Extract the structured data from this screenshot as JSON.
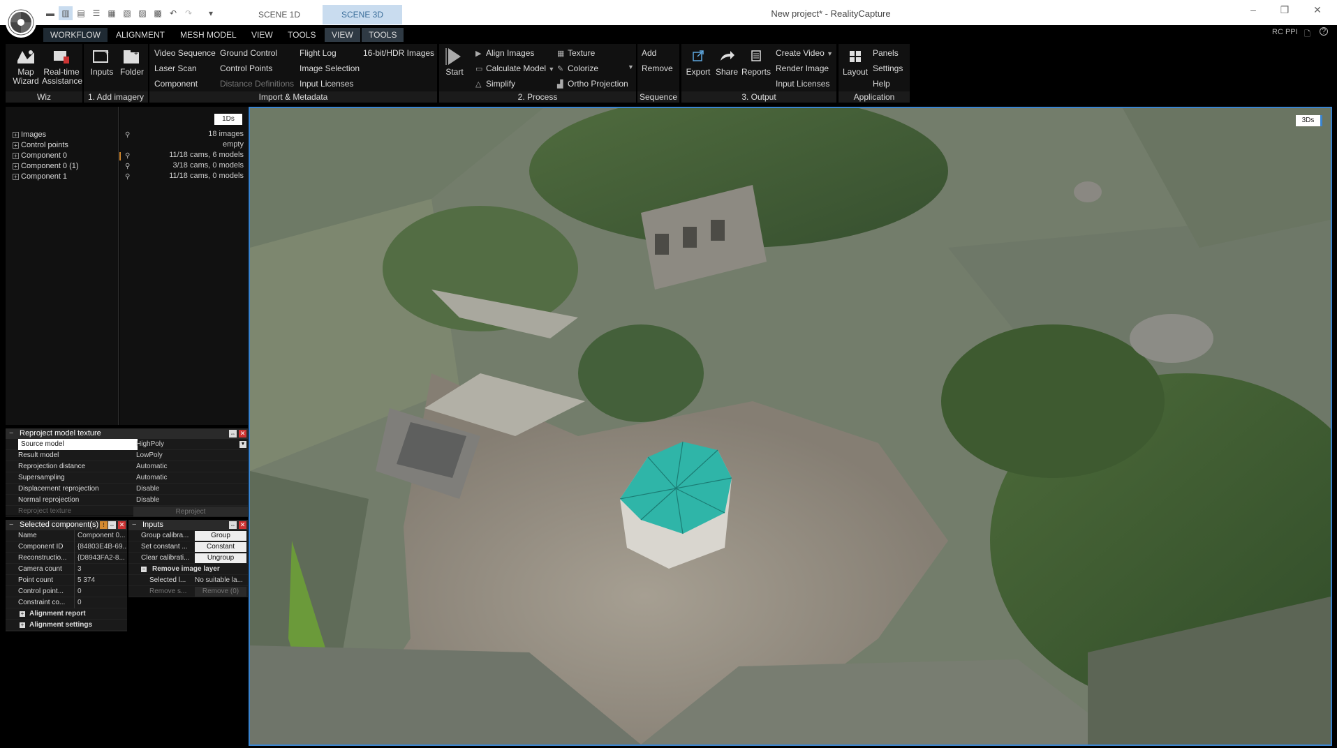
{
  "window": {
    "title": "New project* - RealityCapture",
    "scene_tabs": [
      "SCENE 1D",
      "SCENE 3D"
    ],
    "active_scene": "SCENE 3D"
  },
  "menu": {
    "items": [
      "WORKFLOW",
      "ALIGNMENT",
      "MESH MODEL",
      "VIEW",
      "TOOLS",
      "VIEW",
      "TOOLS"
    ],
    "active": "WORKFLOW",
    "right_label": "RC PPI"
  },
  "ribbon": {
    "wiz": {
      "label": "Wiz",
      "map_wizard": "Map Wizard",
      "realtime": "Real-time Assistance"
    },
    "add_imagery": {
      "label": "1. Add imagery",
      "inputs": "Inputs",
      "folder": "Folder"
    },
    "import": {
      "label": "Import & Metadata",
      "col1": [
        "Video Sequence",
        "Laser Scan",
        "Component"
      ],
      "col2": [
        "Ground Control",
        "Control Points",
        "Distance Definitions"
      ],
      "col3": [
        "Flight Log",
        "Image Selection",
        "Input Licenses"
      ],
      "col4": [
        "16-bit/HDR Images"
      ]
    },
    "process": {
      "label": "2. Process",
      "start": "Start",
      "col1": [
        "Align Images",
        "Calculate Model",
        "Simplify"
      ],
      "col2": [
        "Texture",
        "Colorize",
        "Ortho Projection"
      ]
    },
    "sequence": {
      "label": "Sequence",
      "items": [
        "Add",
        "Remove"
      ]
    },
    "output": {
      "label": "3. Output",
      "export": "Export",
      "share": "Share",
      "reports": "Reports",
      "col": [
        "Create Video",
        "Render Image",
        "Input Licenses"
      ]
    },
    "application": {
      "label": "Application",
      "layout": "Layout",
      "col": [
        "Panels",
        "Settings",
        "Help"
      ]
    }
  },
  "tree": {
    "badge": "1Ds",
    "rows": [
      {
        "label": "Images",
        "value": "18 images",
        "pin": true
      },
      {
        "label": "Control points",
        "value": "empty",
        "pin": false
      },
      {
        "label": "Component 0",
        "value": "11/18 cams, 6 models",
        "pin": true
      },
      {
        "label": "Component 0 (1)",
        "value": "3/18 cams, 0 models",
        "pin": true
      },
      {
        "label": "Component 1",
        "value": "11/18 cams, 0 models",
        "pin": true
      }
    ]
  },
  "reproject": {
    "title": "Reproject model texture",
    "rows": [
      {
        "k": "Source model",
        "v": "HighPoly"
      },
      {
        "k": "Result model",
        "v": "LowPoly"
      },
      {
        "k": "Reprojection distance",
        "v": "Automatic"
      },
      {
        "k": "Supersampling",
        "v": "Automatic"
      },
      {
        "k": "Displacement reprojection",
        "v": "Disable"
      },
      {
        "k": "Normal reprojection",
        "v": "Disable"
      }
    ],
    "action_label": "Reproject texture",
    "action_button": "Reproject"
  },
  "selected_component": {
    "title": "Selected component(s)",
    "rows": [
      {
        "k": "Name",
        "v": "Component 0..."
      },
      {
        "k": "Component ID",
        "v": "{84803E4B-69..."
      },
      {
        "k": "Reconstructio...",
        "v": "{D8943FA2-8..."
      },
      {
        "k": "Camera count",
        "v": "3"
      },
      {
        "k": "Point count",
        "v": "5 374"
      },
      {
        "k": "Control point...",
        "v": "0"
      },
      {
        "k": "Constraint co...",
        "v": "0"
      }
    ],
    "sections": [
      "Alignment report",
      "Alignment settings"
    ]
  },
  "inputs_panel": {
    "title": "Inputs",
    "rows": [
      {
        "k": "Group calibra...",
        "btn": "Group"
      },
      {
        "k": "Set constant ...",
        "btn": "Constant"
      },
      {
        "k": "Clear calibrati...",
        "btn": "Ungroup"
      }
    ],
    "section": "Remove image layer",
    "sub_rows": [
      {
        "k": "Selected l...",
        "v": "No suitable la..."
      },
      {
        "k": "Remove s...",
        "btn": "Remove (0)"
      }
    ]
  },
  "viewport": {
    "badge": "3Ds"
  },
  "colors": {
    "accent": "#3a84d0",
    "scene_tab": "#c9dcef",
    "roof": "#2fb5a8"
  }
}
